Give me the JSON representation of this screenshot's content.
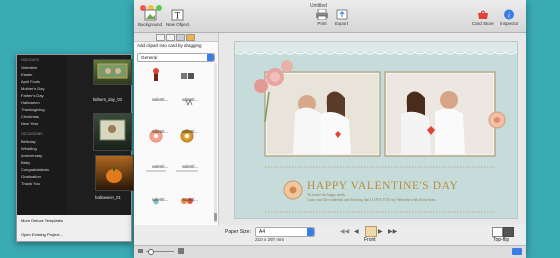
{
  "window": {
    "title": "Untitled"
  },
  "toolbar": {
    "background_label": "Background",
    "new_object_label": "New Object",
    "print_label": "Print",
    "export_label": "Export",
    "card_store_label": "Card Store",
    "inspector_label": "Inspector"
  },
  "left_panel": {
    "holidays_header": "HOLIDAYS",
    "holiday_items": [
      "Valentine",
      "Easter",
      "April Fools",
      "Mother's Day",
      "Father's Day",
      "Halloween",
      "Thanksgiving",
      "Christmas",
      "New Year"
    ],
    "occasions_header": "OCCASIONS",
    "occasion_items": [
      "Birthday",
      "Wedding",
      "Anniversary",
      "Baby",
      "Congratulations",
      "Graduation",
      "Thank You"
    ],
    "templates": [
      "fathers_day_03",
      "halloween_01"
    ],
    "more_templates": "More Deluxe Templates",
    "open_existing": "Open Existing Project..."
  },
  "clipart": {
    "hint": "Add clipart into card by dragging",
    "category": "General",
    "item_caption": "valenti..."
  },
  "card": {
    "headline": "HAPPY VALENTINE'S DAY",
    "sub_line1": "To ensure the happy smile,",
    "sub_line2": "I just your life wonderful and the thing that I LOVE YOU my Valentine with all my heart."
  },
  "bottom": {
    "paper_size_label": "Paper Size:",
    "paper_size_value": "A4",
    "dimensions": "210 x 297 mm",
    "page_label": "Front",
    "flip_label": "Top-flip"
  },
  "colors": {
    "desktop": "#3aaab3",
    "accent_blue": "#3b7de6",
    "card_bg": "#c6dcda",
    "headline": "#b78c3d"
  }
}
